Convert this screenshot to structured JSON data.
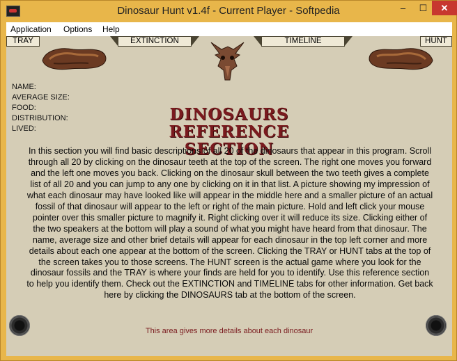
{
  "window": {
    "title": "Dinosaur Hunt v1.4f - Current Player - Softpedia",
    "controls": {
      "minimize": "–",
      "maximize": "☐",
      "close": "✕"
    }
  },
  "menu": [
    "Application",
    "Options",
    "Help"
  ],
  "tabs": {
    "tray": "TRAY",
    "extinction": "EXTINCTION",
    "timeline": "TIMELINE",
    "hunt": "HUNT"
  },
  "info": {
    "name": "NAME:",
    "average_size": "AVERAGE SIZE:",
    "food": "FOOD:",
    "distribution": "DISTRIBUTION:",
    "lived": "LIVED:"
  },
  "heading": {
    "line1": "DINOSAURS",
    "line2": "REFERENCE SECTION"
  },
  "description": "In this section you will find basic descriptions of all 20 of the dinosaurs that appear in this program. Scroll through all 20 by clicking on the dinosaur teeth at the top of the screen. The right one moves you forward and the left one moves you back. Clicking on the dinosaur skull between the two teeth gives a complete list of all 20 and you can jump to any one by clicking on it in that list. A picture showing my impression of what each dinosaur may have looked like will appear in the middle here and a smaller picture of an actual fossil of that dinosaur will appear to the left or right of the main picture. Hold and left click your mouse pointer over this smaller picture to magnify it. Right clicking over it will reduce its size. Clicking either of the two speakers at the bottom will play a sound of what you might have heard from that dinosaur. The name, average size and other brief details will appear for each dinosaur in the top left corner and more details about each one appear at the bottom of the screen. Clicking the TRAY or HUNT tabs at the top of the screen takes you to those screens. The HUNT screen is the actual game where you look for the dinosaur fossils and the TRAY is where your finds are held for you to identify. Use this reference section to help you identify them. Check out the EXTINCTION and TIMELINE tabs for other information. Get back here by clicking the DINOSAURS tab at the bottom of the screen.",
  "footer": "This area gives more details about each dinosaur",
  "colors": {
    "titlebar": "#e8b64a",
    "background": "#d5cdb6",
    "heading": "#7a1a1e",
    "close": "#c7372f"
  }
}
